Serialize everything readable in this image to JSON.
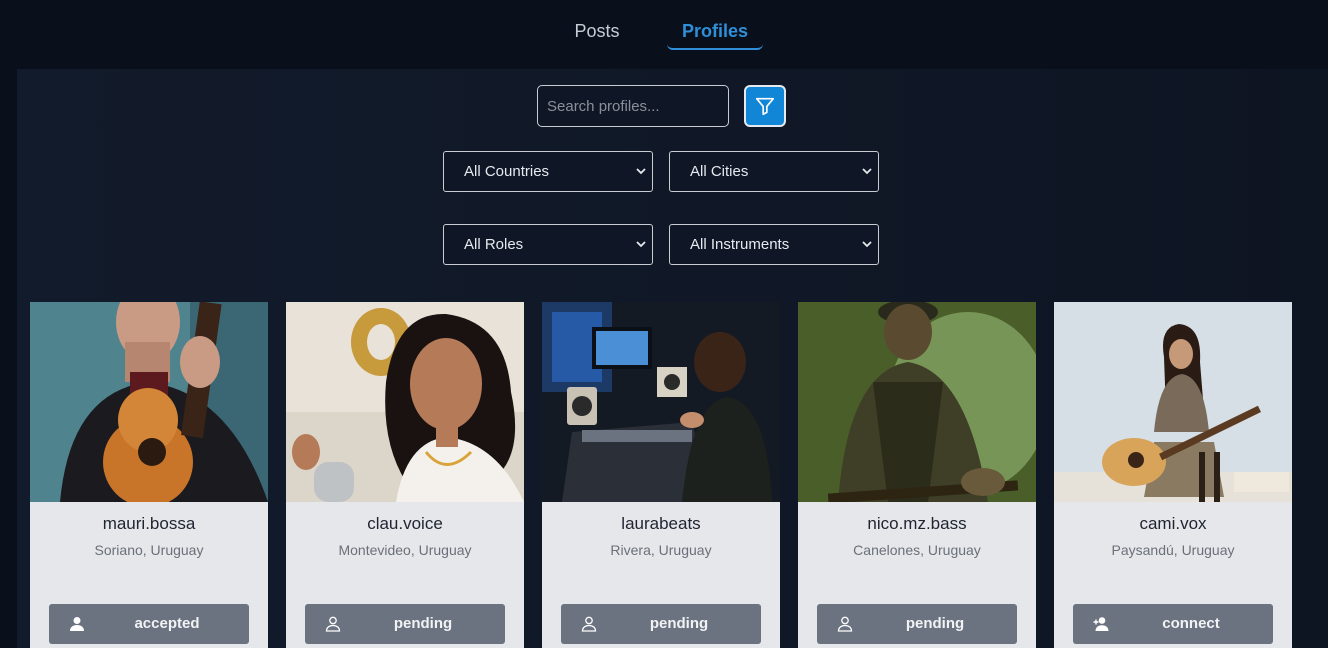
{
  "tabs": [
    {
      "label": "Posts",
      "active": false
    },
    {
      "label": "Profiles",
      "active": true
    }
  ],
  "search": {
    "placeholder": "Search profiles...",
    "value": ""
  },
  "filter_button": {
    "icon": "filter-icon",
    "color": "#1185d6"
  },
  "filters": {
    "country": "All Countries",
    "city": "All Cities",
    "role": "All Roles",
    "instrument": "All Instruments"
  },
  "profiles": [
    {
      "username": "mauri.bossa",
      "location": "Soriano, Uruguay",
      "action": "accepted",
      "action_icon": "user-filled-icon"
    },
    {
      "username": "clau.voice",
      "location": "Montevideo, Uruguay",
      "action": "pending",
      "action_icon": "user-outline-icon"
    },
    {
      "username": "laurabeats",
      "location": "Rivera, Uruguay",
      "action": "pending",
      "action_icon": "user-outline-icon"
    },
    {
      "username": "nico.mz.bass",
      "location": "Canelones, Uruguay",
      "action": "pending",
      "action_icon": "user-outline-icon"
    },
    {
      "username": "cami.vox",
      "location": "Paysandú, Uruguay",
      "action": "connect",
      "action_icon": "user-plus-icon"
    }
  ]
}
